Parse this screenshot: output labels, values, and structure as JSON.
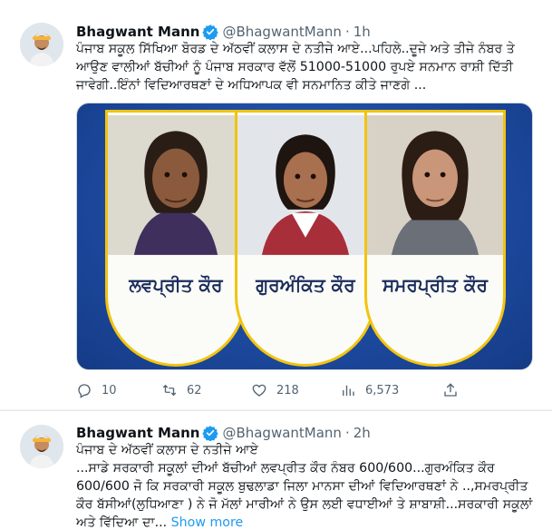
{
  "tweets": [
    {
      "author_name": "Bhagwant Mann",
      "handle": "@BhagwantMann",
      "separator": "·",
      "time": "1h",
      "text": "ਪੰਜਾਬ ਸਕੂਲ ਸਿੱਖਿਆ ਬੋਰਡ ਦੇ ਅੱਠਵੀਂ ਕਲਾਸ ਦੇ ਨਤੀਜੇ ਆਏ...ਪਹਿਲੇ..ਦੂਜੇ ਅਤੇ ਤੀਜੇ ਨੰਬਰ ਤੇ ਆਉਣ ਵਾਲੀਆਂ ਬੱਚੀਆਂ ਨੂੰ ਪੰਜਾਬ ਸਰਕਾਰ ਵੱਲੋਂ 51000-51000 ਰੁਪਏ ਸਨਮਾਨ ਰਾਸ਼ੀ ਦਿੱਤੀ ਜਾਵੇਗੀ..ਇੰਨਾਂ ਵਿਦਿਆਰਥਣਾਂ ਦੇ ਅਧਿਆਪਕ ਵੀ ਸਨਮਾਨਿਤ ਕੀਤੇ ਜਾਣਗੇ ...",
      "media": {
        "names": [
          "ਲਵਪ੍ਰੀਤ ਕੌਰ",
          "ਗੁਰਅੰਕਿਤ ਕੌਰ",
          "ਸਮਰਪ੍ਰੀਤ ਕੌਰ"
        ]
      },
      "stats": {
        "replies": "10",
        "retweets": "62",
        "likes": "218",
        "views": "6,573"
      }
    },
    {
      "author_name": "Bhagwant Mann",
      "handle": "@BhagwantMann",
      "separator": "·",
      "time": "2h",
      "text_line1": "ਪੰਜਾਬ ਦੇ ਅੱਠਵੀਂ ਕਲਾਸ ਦੇ ਨਤੀਜੇ ਆਏ",
      "text_rest": "...ਸਾਡੇ ਸਰਕਾਰੀ ਸਕੂਲਾਂ ਦੀਆਂ ਬੱਚੀਆਂ ਲਵਪ੍ਰੀਤ ਕੌਰ ਨੰਬਰ 600/600...ਗੁਰਅੰਕਿਤ ਕੌਰ 600/600 ਜੋ ਕਿ ਸਰਕਾਰੀ ਸਕੂਲ ਬੁਢਲਾਡਾ ਜਿਲਾ ਮਾਨਸਾ ਦੀਆਂ ਵਿਦਿਆਰਥਣਾਂ ਨੇ ..,ਸਮਰਪ੍ਰੀਤ ਕੌਰ ਬੱਸੀਆਂ(ਲੁਧਿਆਣਾ ) ਨੇ ਜੋ ਮੱਲਾਂ ਮਾਰੀਆਂ ਨੇ ਉਸ ਲਈ ਵਧਾਈਆਂ ਤੇ ਸ਼ਾਬਾਸ਼ੀ...ਸਰਕਾਰੀ ਸਕੂਲਾਂ ਅਤੇ ਵਿੱਦਿਆ ਦਾ...",
      "show_more": "Show more"
    }
  ],
  "icons": {
    "verified": "verified-badge-icon",
    "reply": "reply-icon",
    "retweet": "retweet-icon",
    "like": "heart-icon",
    "views": "views-icon",
    "share": "share-icon"
  },
  "colors": {
    "accent": "#1d9bf0",
    "secondary_text": "#536471",
    "media_background": "#1d4aa0",
    "card_border": "#f1c40f"
  }
}
